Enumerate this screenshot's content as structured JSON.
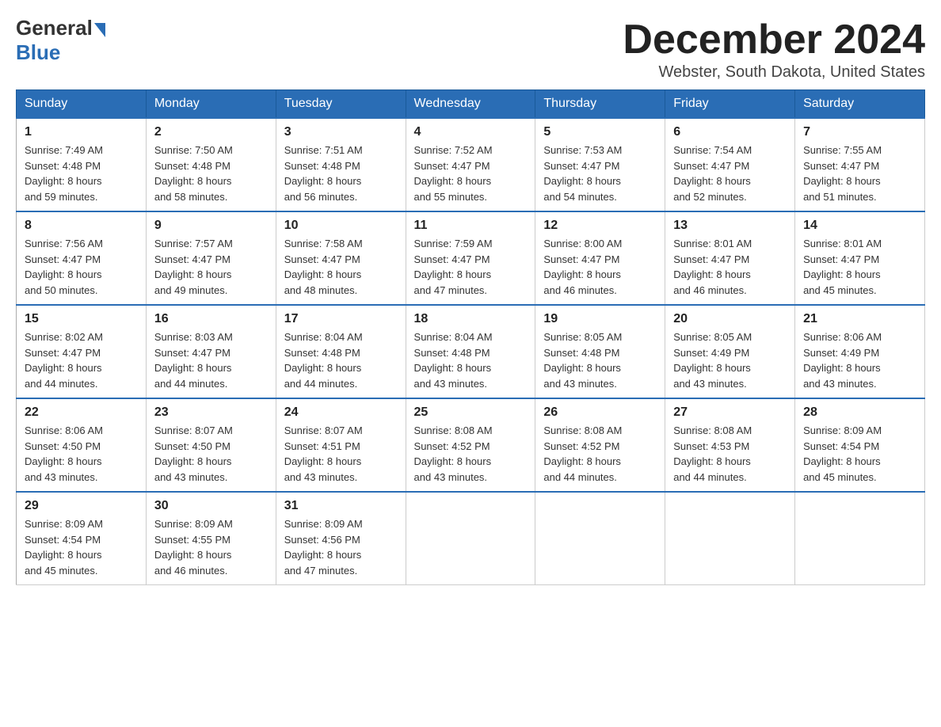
{
  "header": {
    "logo_general": "General",
    "logo_blue": "Blue",
    "title": "December 2024",
    "location": "Webster, South Dakota, United States"
  },
  "days_of_week": [
    "Sunday",
    "Monday",
    "Tuesday",
    "Wednesday",
    "Thursday",
    "Friday",
    "Saturday"
  ],
  "weeks": [
    [
      {
        "day": "1",
        "sunrise": "7:49 AM",
        "sunset": "4:48 PM",
        "daylight": "8 hours and 59 minutes."
      },
      {
        "day": "2",
        "sunrise": "7:50 AM",
        "sunset": "4:48 PM",
        "daylight": "8 hours and 58 minutes."
      },
      {
        "day": "3",
        "sunrise": "7:51 AM",
        "sunset": "4:48 PM",
        "daylight": "8 hours and 56 minutes."
      },
      {
        "day": "4",
        "sunrise": "7:52 AM",
        "sunset": "4:47 PM",
        "daylight": "8 hours and 55 minutes."
      },
      {
        "day": "5",
        "sunrise": "7:53 AM",
        "sunset": "4:47 PM",
        "daylight": "8 hours and 54 minutes."
      },
      {
        "day": "6",
        "sunrise": "7:54 AM",
        "sunset": "4:47 PM",
        "daylight": "8 hours and 52 minutes."
      },
      {
        "day": "7",
        "sunrise": "7:55 AM",
        "sunset": "4:47 PM",
        "daylight": "8 hours and 51 minutes."
      }
    ],
    [
      {
        "day": "8",
        "sunrise": "7:56 AM",
        "sunset": "4:47 PM",
        "daylight": "8 hours and 50 minutes."
      },
      {
        "day": "9",
        "sunrise": "7:57 AM",
        "sunset": "4:47 PM",
        "daylight": "8 hours and 49 minutes."
      },
      {
        "day": "10",
        "sunrise": "7:58 AM",
        "sunset": "4:47 PM",
        "daylight": "8 hours and 48 minutes."
      },
      {
        "day": "11",
        "sunrise": "7:59 AM",
        "sunset": "4:47 PM",
        "daylight": "8 hours and 47 minutes."
      },
      {
        "day": "12",
        "sunrise": "8:00 AM",
        "sunset": "4:47 PM",
        "daylight": "8 hours and 46 minutes."
      },
      {
        "day": "13",
        "sunrise": "8:01 AM",
        "sunset": "4:47 PM",
        "daylight": "8 hours and 46 minutes."
      },
      {
        "day": "14",
        "sunrise": "8:01 AM",
        "sunset": "4:47 PM",
        "daylight": "8 hours and 45 minutes."
      }
    ],
    [
      {
        "day": "15",
        "sunrise": "8:02 AM",
        "sunset": "4:47 PM",
        "daylight": "8 hours and 44 minutes."
      },
      {
        "day": "16",
        "sunrise": "8:03 AM",
        "sunset": "4:47 PM",
        "daylight": "8 hours and 44 minutes."
      },
      {
        "day": "17",
        "sunrise": "8:04 AM",
        "sunset": "4:48 PM",
        "daylight": "8 hours and 44 minutes."
      },
      {
        "day": "18",
        "sunrise": "8:04 AM",
        "sunset": "4:48 PM",
        "daylight": "8 hours and 43 minutes."
      },
      {
        "day": "19",
        "sunrise": "8:05 AM",
        "sunset": "4:48 PM",
        "daylight": "8 hours and 43 minutes."
      },
      {
        "day": "20",
        "sunrise": "8:05 AM",
        "sunset": "4:49 PM",
        "daylight": "8 hours and 43 minutes."
      },
      {
        "day": "21",
        "sunrise": "8:06 AM",
        "sunset": "4:49 PM",
        "daylight": "8 hours and 43 minutes."
      }
    ],
    [
      {
        "day": "22",
        "sunrise": "8:06 AM",
        "sunset": "4:50 PM",
        "daylight": "8 hours and 43 minutes."
      },
      {
        "day": "23",
        "sunrise": "8:07 AM",
        "sunset": "4:50 PM",
        "daylight": "8 hours and 43 minutes."
      },
      {
        "day": "24",
        "sunrise": "8:07 AM",
        "sunset": "4:51 PM",
        "daylight": "8 hours and 43 minutes."
      },
      {
        "day": "25",
        "sunrise": "8:08 AM",
        "sunset": "4:52 PM",
        "daylight": "8 hours and 43 minutes."
      },
      {
        "day": "26",
        "sunrise": "8:08 AM",
        "sunset": "4:52 PM",
        "daylight": "8 hours and 44 minutes."
      },
      {
        "day": "27",
        "sunrise": "8:08 AM",
        "sunset": "4:53 PM",
        "daylight": "8 hours and 44 minutes."
      },
      {
        "day": "28",
        "sunrise": "8:09 AM",
        "sunset": "4:54 PM",
        "daylight": "8 hours and 45 minutes."
      }
    ],
    [
      {
        "day": "29",
        "sunrise": "8:09 AM",
        "sunset": "4:54 PM",
        "daylight": "8 hours and 45 minutes."
      },
      {
        "day": "30",
        "sunrise": "8:09 AM",
        "sunset": "4:55 PM",
        "daylight": "8 hours and 46 minutes."
      },
      {
        "day": "31",
        "sunrise": "8:09 AM",
        "sunset": "4:56 PM",
        "daylight": "8 hours and 47 minutes."
      },
      null,
      null,
      null,
      null
    ]
  ],
  "labels": {
    "sunrise": "Sunrise:",
    "sunset": "Sunset:",
    "daylight": "Daylight:"
  }
}
